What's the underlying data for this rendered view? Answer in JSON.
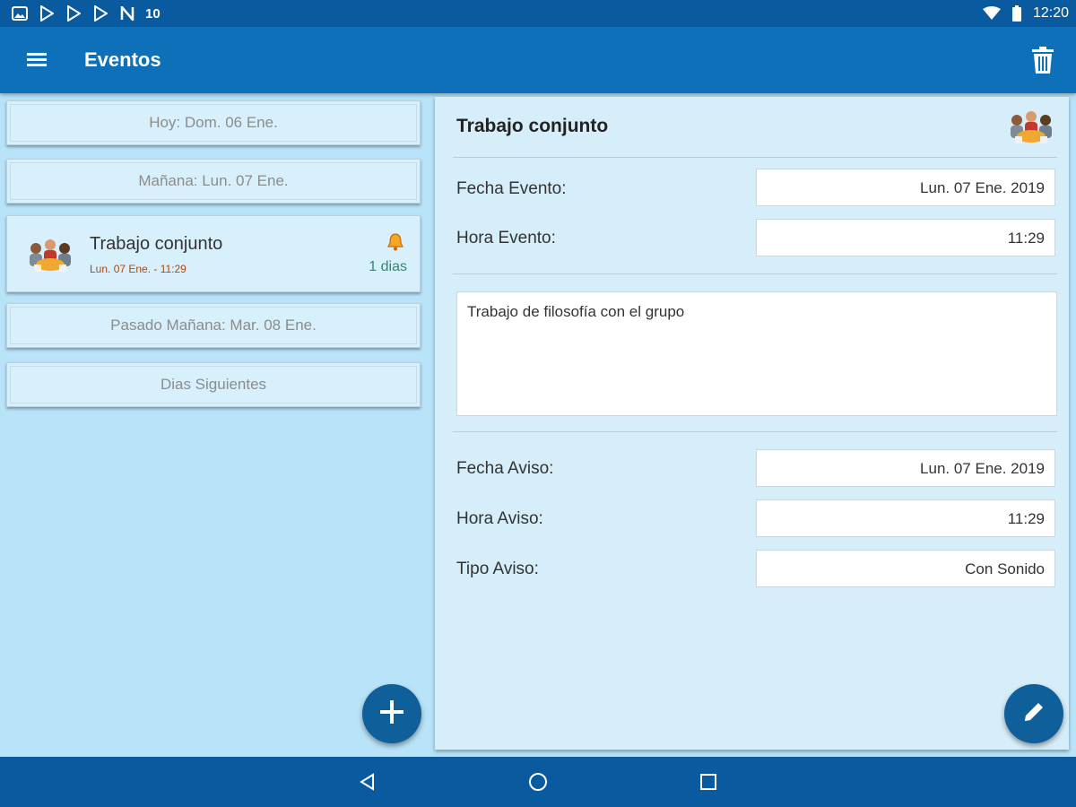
{
  "status_bar": {
    "left_icons": [
      "gallery-icon",
      "play-store-icon",
      "play-store-icon",
      "play-store-icon",
      "n-icon"
    ],
    "left_number": "10",
    "time": "12:20",
    "right_icons": [
      "wifi-icon",
      "battery-icon"
    ]
  },
  "app_bar": {
    "title": "Eventos",
    "menu_icon": "hamburger-menu-icon",
    "action_icon": "trash-icon"
  },
  "list": {
    "today_header": "Hoy: Dom. 06 Ene.",
    "tomorrow_header": "Mañana: Lun. 07 Ene.",
    "event": {
      "title": "Trabajo conjunto",
      "subtitle": "Lun. 07 Ene. - 11:29",
      "days": "1 dias",
      "icon": "group-people-icon",
      "alarm_icon": "bell-icon"
    },
    "day_after_header": "Pasado Mañana: Mar. 08 Ene.",
    "following_header": "Dias Siguientes"
  },
  "detail": {
    "title": "Trabajo conjunto",
    "fecha_evento_label": "Fecha Evento:",
    "fecha_evento_value": "Lun. 07 Ene. 2019",
    "hora_evento_label": "Hora Evento:",
    "hora_evento_value": "11:29",
    "description": "Trabajo de filosofía con el grupo",
    "fecha_aviso_label": "Fecha Aviso:",
    "fecha_aviso_value": "Lun. 07 Ene. 2019",
    "hora_aviso_label": "Hora Aviso:",
    "hora_aviso_value": "11:29",
    "tipo_aviso_label": "Tipo Aviso:",
    "tipo_aviso_value": "Con Sonido"
  },
  "fab": {
    "add_icon": "plus-icon",
    "edit_icon": "pencil-icon"
  },
  "nav_bar": {
    "icons": [
      "back-triangle-icon",
      "home-circle-icon",
      "recents-square-icon"
    ]
  },
  "colors": {
    "status_bar": "#0a5aa0",
    "app_bar": "#0d70b8",
    "background": "#b9e3f8",
    "card": "#d8f0fb",
    "fab": "#0e5f9a",
    "days_text": "#2d8c6e",
    "subtitle_text": "#a34b14"
  }
}
